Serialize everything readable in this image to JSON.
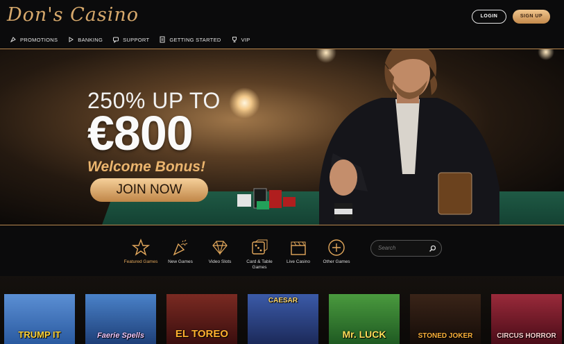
{
  "brand": {
    "logo_text": "Don's Casino",
    "accent": "#d7a96c"
  },
  "header": {
    "login_label": "LOGIN",
    "signup_label": "SIGN UP"
  },
  "nav": [
    {
      "label": "PROMOTIONS",
      "icon": "rocket-icon"
    },
    {
      "label": "BANKING",
      "icon": "play-icon"
    },
    {
      "label": "SUPPORT",
      "icon": "chat-icon"
    },
    {
      "label": "GETTING STARTED",
      "icon": "document-icon"
    },
    {
      "label": "VIP",
      "icon": "trophy-icon"
    }
  ],
  "hero": {
    "line1": "250% UP TO",
    "line2": "€800",
    "line3": "Welcome Bonus!",
    "cta_label": "JOIN NOW"
  },
  "categories": [
    {
      "label": "Featured Games",
      "icon": "star-icon",
      "active": true
    },
    {
      "label": "New Games",
      "icon": "party-popper-icon",
      "active": false
    },
    {
      "label": "Video Slots",
      "icon": "diamond-icon",
      "active": false
    },
    {
      "label": "Card & Table Games",
      "icon": "dice-icon",
      "active": false
    },
    {
      "label": "Live Casino",
      "icon": "clapperboard-icon",
      "active": false
    },
    {
      "label": "Other Games",
      "icon": "plus-circle-icon",
      "active": false
    }
  ],
  "search": {
    "placeholder": "Search"
  },
  "games": [
    {
      "title": "TRUMP IT",
      "bg": "#3b6fb5",
      "color": "#ffd43a"
    },
    {
      "title": "Faerie Spells",
      "bg": "#2f5a9a",
      "color": "#f0c8ff"
    },
    {
      "title": "EL TOREO",
      "bg": "#5a1a1a",
      "color": "#ffb02e"
    },
    {
      "title": "CAESAR",
      "bg": "#2c3f78",
      "color": "#ffd86a"
    },
    {
      "title": "Mr. LUCK",
      "bg": "#2f6d2a",
      "color": "#ffe05a"
    },
    {
      "title": "STONED JOKER",
      "bg": "#2a1a12",
      "color": "#ffb23a"
    },
    {
      "title": "CIRCUS HORROR",
      "bg": "#7a1a2a",
      "color": "#ffd0d0"
    }
  ]
}
